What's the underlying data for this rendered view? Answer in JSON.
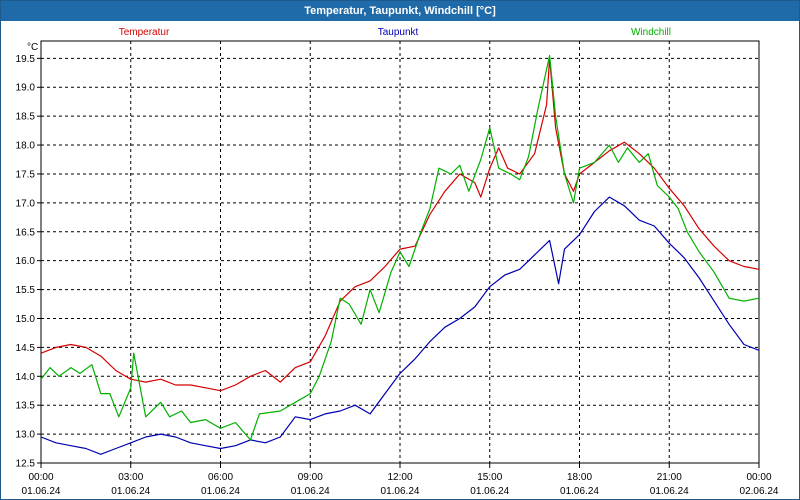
{
  "window": {
    "title": "Temperatur, Taupunkt, Windchill [°C]"
  },
  "colors": {
    "temperatur": "#d40000",
    "taupunkt": "#0000b0",
    "windchill": "#00b000",
    "grid": "#000000",
    "titlebar": "#1f6aa8"
  },
  "chart_data": {
    "type": "line",
    "ylabel": "°C",
    "ylim": [
      12.5,
      19.8
    ],
    "xlim": [
      0,
      24
    ],
    "grid": true,
    "legend_position": "top",
    "yticks": [
      "12.5",
      "13.0",
      "13.5",
      "14.0",
      "14.5",
      "15.0",
      "15.5",
      "16.0",
      "16.5",
      "17.0",
      "17.5",
      "18.0",
      "18.5",
      "19.0",
      "19.5"
    ],
    "xticks": [
      {
        "time": "00:00",
        "date": "01.06.24"
      },
      {
        "time": "03:00",
        "date": "01.06.24"
      },
      {
        "time": "06:00",
        "date": "01.06.24"
      },
      {
        "time": "09:00",
        "date": "01.06.24"
      },
      {
        "time": "12:00",
        "date": "01.06.24"
      },
      {
        "time": "15:00",
        "date": "01.06.24"
      },
      {
        "time": "18:00",
        "date": "01.06.24"
      },
      {
        "time": "21:00",
        "date": "01.06.24"
      },
      {
        "time": "00:00",
        "date": "02.06.24"
      }
    ],
    "series": [
      {
        "name": "Temperatur",
        "points": [
          [
            0,
            14.4
          ],
          [
            0.5,
            14.5
          ],
          [
            1,
            14.55
          ],
          [
            1.5,
            14.5
          ],
          [
            2,
            14.35
          ],
          [
            2.5,
            14.1
          ],
          [
            3,
            13.95
          ],
          [
            3.5,
            13.9
          ],
          [
            4,
            13.95
          ],
          [
            4.5,
            13.85
          ],
          [
            5,
            13.85
          ],
          [
            5.5,
            13.8
          ],
          [
            6,
            13.75
          ],
          [
            6.5,
            13.85
          ],
          [
            7,
            14.0
          ],
          [
            7.5,
            14.1
          ],
          [
            8,
            13.9
          ],
          [
            8.5,
            14.15
          ],
          [
            9,
            14.25
          ],
          [
            9.5,
            14.7
          ],
          [
            10,
            15.3
          ],
          [
            10.5,
            15.55
          ],
          [
            11,
            15.65
          ],
          [
            11.5,
            15.9
          ],
          [
            12,
            16.2
          ],
          [
            12.5,
            16.25
          ],
          [
            13,
            16.8
          ],
          [
            13.5,
            17.2
          ],
          [
            14,
            17.5
          ],
          [
            14.5,
            17.35
          ],
          [
            14.7,
            17.1
          ],
          [
            15,
            17.6
          ],
          [
            15.3,
            17.95
          ],
          [
            15.6,
            17.6
          ],
          [
            16,
            17.5
          ],
          [
            16.5,
            17.85
          ],
          [
            16.9,
            18.7
          ],
          [
            17,
            19.5
          ],
          [
            17.2,
            18.3
          ],
          [
            17.5,
            17.5
          ],
          [
            17.8,
            17.2
          ],
          [
            18,
            17.5
          ],
          [
            18.5,
            17.7
          ],
          [
            19,
            17.9
          ],
          [
            19.5,
            18.05
          ],
          [
            20,
            17.85
          ],
          [
            20.5,
            17.6
          ],
          [
            21,
            17.25
          ],
          [
            21.5,
            16.95
          ],
          [
            22,
            16.55
          ],
          [
            22.5,
            16.25
          ],
          [
            23,
            16.0
          ],
          [
            23.5,
            15.9
          ],
          [
            24,
            15.85
          ]
        ]
      },
      {
        "name": "Taupunkt",
        "points": [
          [
            0,
            12.95
          ],
          [
            0.5,
            12.85
          ],
          [
            1,
            12.8
          ],
          [
            1.5,
            12.75
          ],
          [
            2,
            12.65
          ],
          [
            2.5,
            12.75
          ],
          [
            3,
            12.85
          ],
          [
            3.5,
            12.95
          ],
          [
            4,
            13.0
          ],
          [
            4.5,
            12.95
          ],
          [
            5,
            12.85
          ],
          [
            5.5,
            12.8
          ],
          [
            6,
            12.75
          ],
          [
            6.5,
            12.8
          ],
          [
            7,
            12.9
          ],
          [
            7.5,
            12.85
          ],
          [
            8,
            12.95
          ],
          [
            8.5,
            13.3
          ],
          [
            9,
            13.25
          ],
          [
            9.5,
            13.35
          ],
          [
            10,
            13.4
          ],
          [
            10.5,
            13.5
          ],
          [
            11,
            13.35
          ],
          [
            11.5,
            13.7
          ],
          [
            12,
            14.05
          ],
          [
            12.5,
            14.3
          ],
          [
            13,
            14.6
          ],
          [
            13.5,
            14.85
          ],
          [
            14,
            15.0
          ],
          [
            14.5,
            15.2
          ],
          [
            15,
            15.55
          ],
          [
            15.5,
            15.75
          ],
          [
            16,
            15.85
          ],
          [
            16.5,
            16.1
          ],
          [
            17,
            16.35
          ],
          [
            17.3,
            15.6
          ],
          [
            17.5,
            16.2
          ],
          [
            18,
            16.45
          ],
          [
            18.5,
            16.85
          ],
          [
            19,
            17.1
          ],
          [
            19.5,
            16.95
          ],
          [
            20,
            16.7
          ],
          [
            20.5,
            16.6
          ],
          [
            21,
            16.3
          ],
          [
            21.5,
            16.05
          ],
          [
            22,
            15.7
          ],
          [
            22.5,
            15.3
          ],
          [
            23,
            14.9
          ],
          [
            23.5,
            14.55
          ],
          [
            24,
            14.45
          ]
        ]
      },
      {
        "name": "Windchill",
        "points": [
          [
            0,
            13.95
          ],
          [
            0.3,
            14.15
          ],
          [
            0.6,
            14.0
          ],
          [
            1,
            14.15
          ],
          [
            1.3,
            14.05
          ],
          [
            1.7,
            14.2
          ],
          [
            2,
            13.7
          ],
          [
            2.3,
            13.7
          ],
          [
            2.6,
            13.3
          ],
          [
            3,
            13.8
          ],
          [
            3.1,
            14.4
          ],
          [
            3.5,
            13.3
          ],
          [
            4,
            13.55
          ],
          [
            4.3,
            13.3
          ],
          [
            4.7,
            13.4
          ],
          [
            5,
            13.2
          ],
          [
            5.5,
            13.25
          ],
          [
            6,
            13.1
          ],
          [
            6.5,
            13.2
          ],
          [
            7,
            12.9
          ],
          [
            7.3,
            13.35
          ],
          [
            8,
            13.4
          ],
          [
            8.5,
            13.55
          ],
          [
            9,
            13.7
          ],
          [
            9.3,
            14.0
          ],
          [
            9.7,
            14.6
          ],
          [
            10,
            15.35
          ],
          [
            10.3,
            15.25
          ],
          [
            10.7,
            14.9
          ],
          [
            11,
            15.5
          ],
          [
            11.3,
            15.1
          ],
          [
            11.7,
            15.8
          ],
          [
            12,
            16.15
          ],
          [
            12.3,
            15.9
          ],
          [
            12.7,
            16.5
          ],
          [
            13,
            16.9
          ],
          [
            13.3,
            17.6
          ],
          [
            13.7,
            17.5
          ],
          [
            14,
            17.65
          ],
          [
            14.3,
            17.2
          ],
          [
            14.7,
            17.75
          ],
          [
            15,
            18.3
          ],
          [
            15.3,
            17.6
          ],
          [
            15.7,
            17.5
          ],
          [
            16,
            17.4
          ],
          [
            16.3,
            17.8
          ],
          [
            16.6,
            18.6
          ],
          [
            17,
            19.55
          ],
          [
            17.2,
            18.5
          ],
          [
            17.5,
            17.5
          ],
          [
            17.8,
            17.0
          ],
          [
            18,
            17.6
          ],
          [
            18.5,
            17.7
          ],
          [
            19,
            18.0
          ],
          [
            19.3,
            17.7
          ],
          [
            19.6,
            17.95
          ],
          [
            20,
            17.7
          ],
          [
            20.3,
            17.85
          ],
          [
            20.6,
            17.3
          ],
          [
            21,
            17.1
          ],
          [
            21.3,
            16.9
          ],
          [
            21.6,
            16.5
          ],
          [
            22,
            16.15
          ],
          [
            22.5,
            15.8
          ],
          [
            23,
            15.35
          ],
          [
            23.5,
            15.3
          ],
          [
            24,
            15.35
          ]
        ]
      }
    ]
  }
}
